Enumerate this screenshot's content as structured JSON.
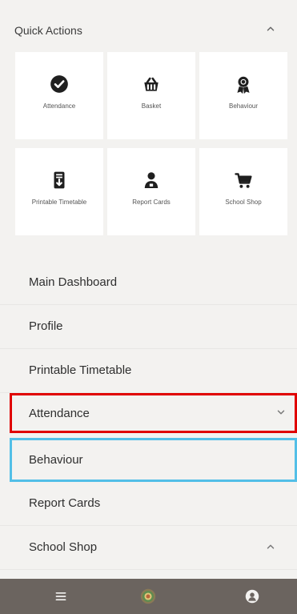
{
  "quick_actions": {
    "title": "Quick Actions",
    "items": [
      {
        "label": "Attendance",
        "icon": "check-circle-icon"
      },
      {
        "label": "Basket",
        "icon": "basket-icon"
      },
      {
        "label": "Behaviour",
        "icon": "award-icon"
      },
      {
        "label": "Printable Timetable",
        "icon": "printable-timetable-icon"
      },
      {
        "label": "Report Cards",
        "icon": "report-cards-icon"
      },
      {
        "label": "School Shop",
        "icon": "cart-icon"
      }
    ]
  },
  "nav": {
    "items": [
      {
        "label": "Main Dashboard"
      },
      {
        "label": "Profile"
      },
      {
        "label": "Printable Timetable"
      },
      {
        "label": "Attendance",
        "chevron": "down"
      },
      {
        "label": "Behaviour"
      },
      {
        "label": "Report Cards"
      },
      {
        "label": "School Shop",
        "chevron": "up"
      }
    ]
  },
  "colors": {
    "attendance_highlight_border": "#e00000",
    "behaviour_highlight_border": "#52bfe7",
    "bottom_nav_bg": "#6b645f"
  }
}
